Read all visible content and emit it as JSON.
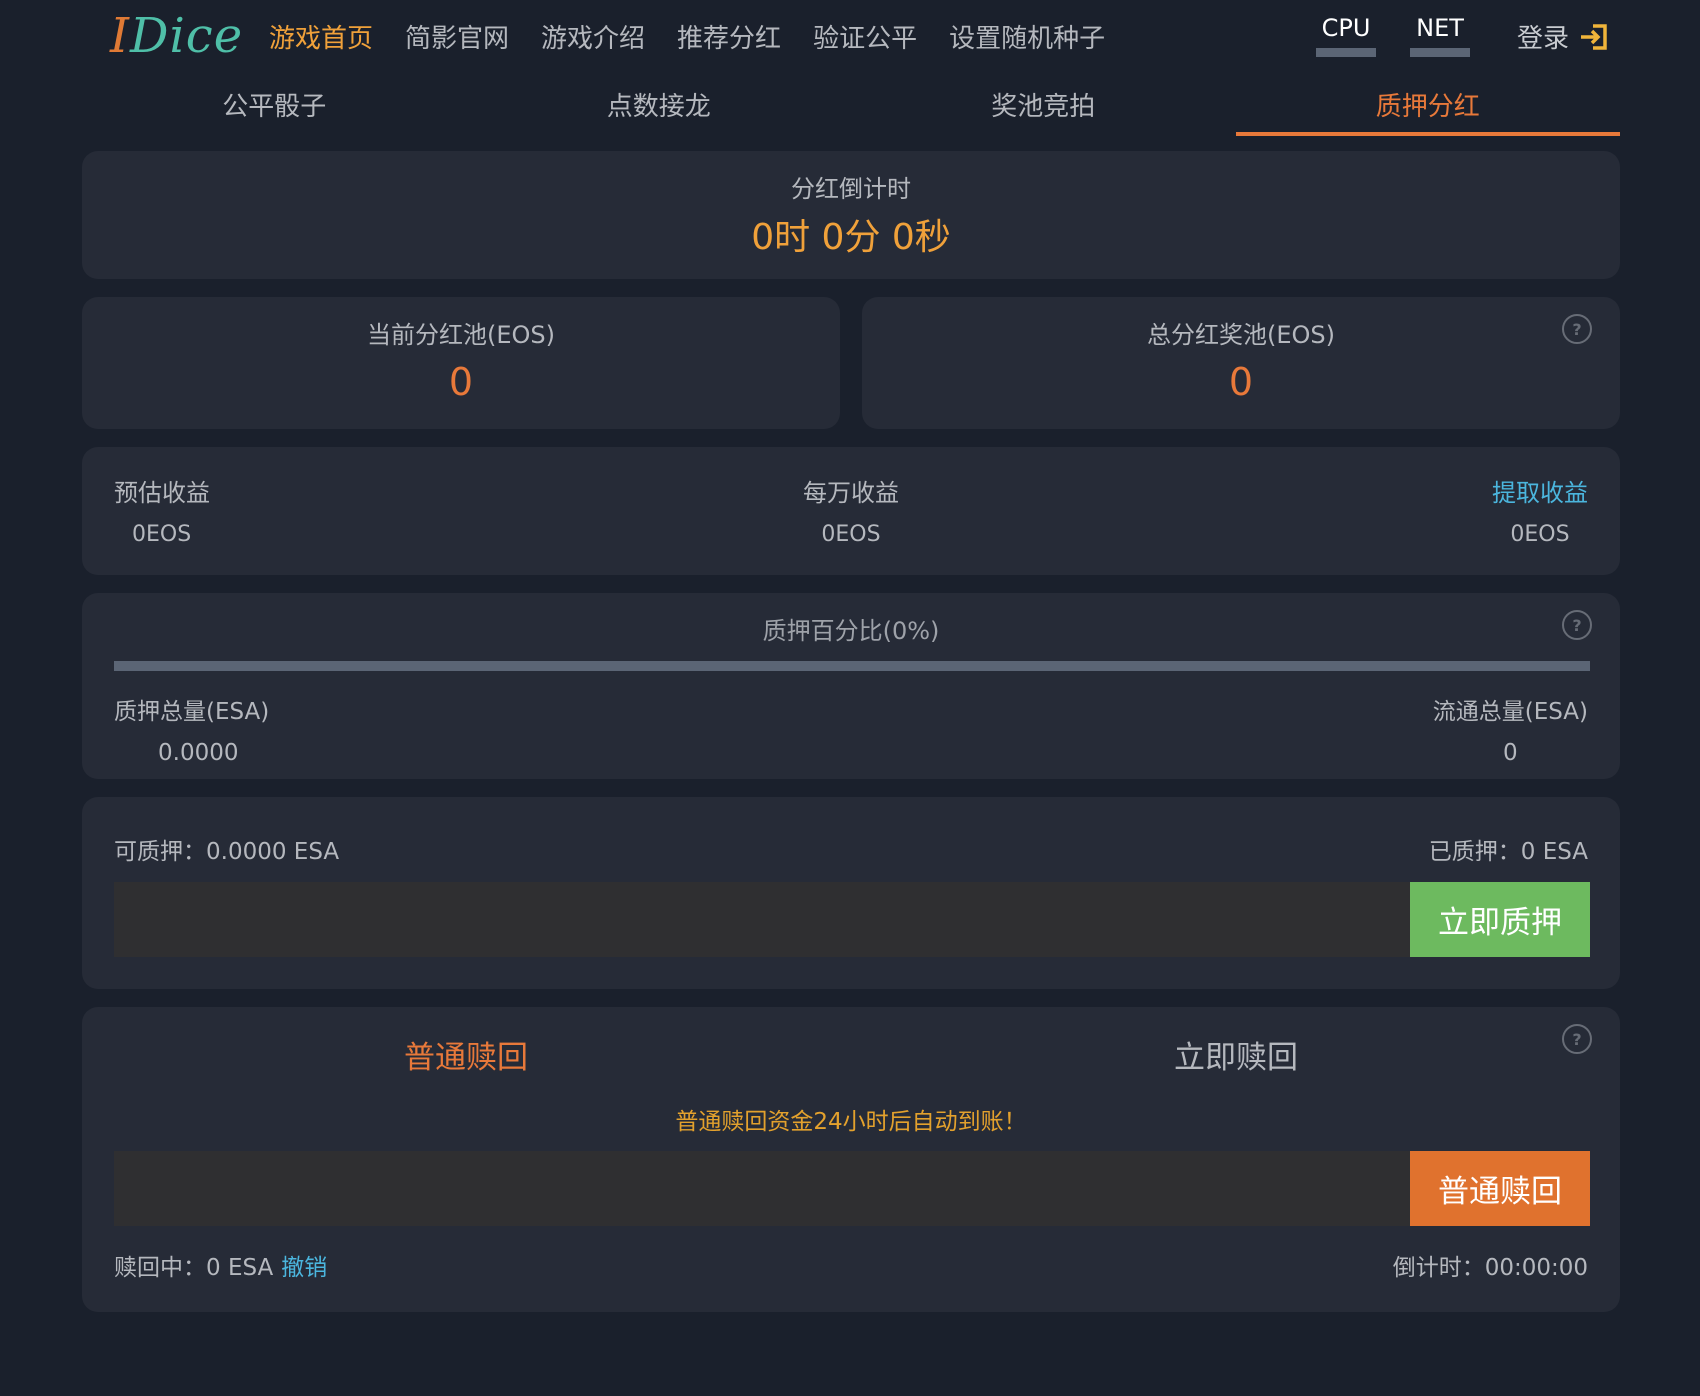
{
  "logo": {
    "part1": "I",
    "part2": "Dice"
  },
  "nav": {
    "items": [
      "游戏首页",
      "简影官网",
      "游戏介绍",
      "推荐分红",
      "验证公平",
      "设置随机种子"
    ],
    "active_index": 0
  },
  "meters": {
    "cpu_label": "CPU",
    "net_label": "NET"
  },
  "login": {
    "label": "登录",
    "icon": "login-arrow-icon"
  },
  "tabs": [
    "公平骰子",
    "点数接龙",
    "奖池竞拍",
    "质押分红"
  ],
  "countdown": {
    "title": "分红倒计时",
    "value": "0时 0分 0秒"
  },
  "pools": {
    "current": {
      "title": "当前分红池(EOS)",
      "value": "0"
    },
    "total": {
      "title": "总分红奖池(EOS)",
      "value": "0"
    }
  },
  "earnings": {
    "estimated": {
      "title": "预估收益",
      "value": "0EOS"
    },
    "per_10k": {
      "title": "每万收益",
      "value": "0EOS"
    },
    "withdraw": {
      "title": "提取收益",
      "value": "0EOS"
    }
  },
  "stake": {
    "title": "质押百分比(0%)",
    "percent": 0,
    "total_staked": {
      "title": "质押总量(ESA)",
      "value": "0.0000"
    },
    "circulating": {
      "title": "流通总量(ESA)",
      "value": "0"
    }
  },
  "pledge": {
    "available": "可质押：0.0000 ESA",
    "staked": "已质押：0 ESA",
    "input_value": "",
    "button": "立即质押"
  },
  "redeem": {
    "tab_normal": "普通赎回",
    "tab_instant": "立即赎回",
    "note": "普通赎回资金24小时后自动到账！",
    "input_value": "",
    "button": "普通赎回",
    "pending": "赎回中：0 ESA",
    "cancel": "撤销",
    "countdown": "倒计时：00:00:00"
  },
  "colors": {
    "background": "#1a202c",
    "card": "#262b37",
    "accent_orange": "#e8793a",
    "accent_gold": "#f0a13a",
    "link_blue": "#4bb6de",
    "stake_green": "#6dba5f",
    "redeem_orange": "#e0722e"
  }
}
